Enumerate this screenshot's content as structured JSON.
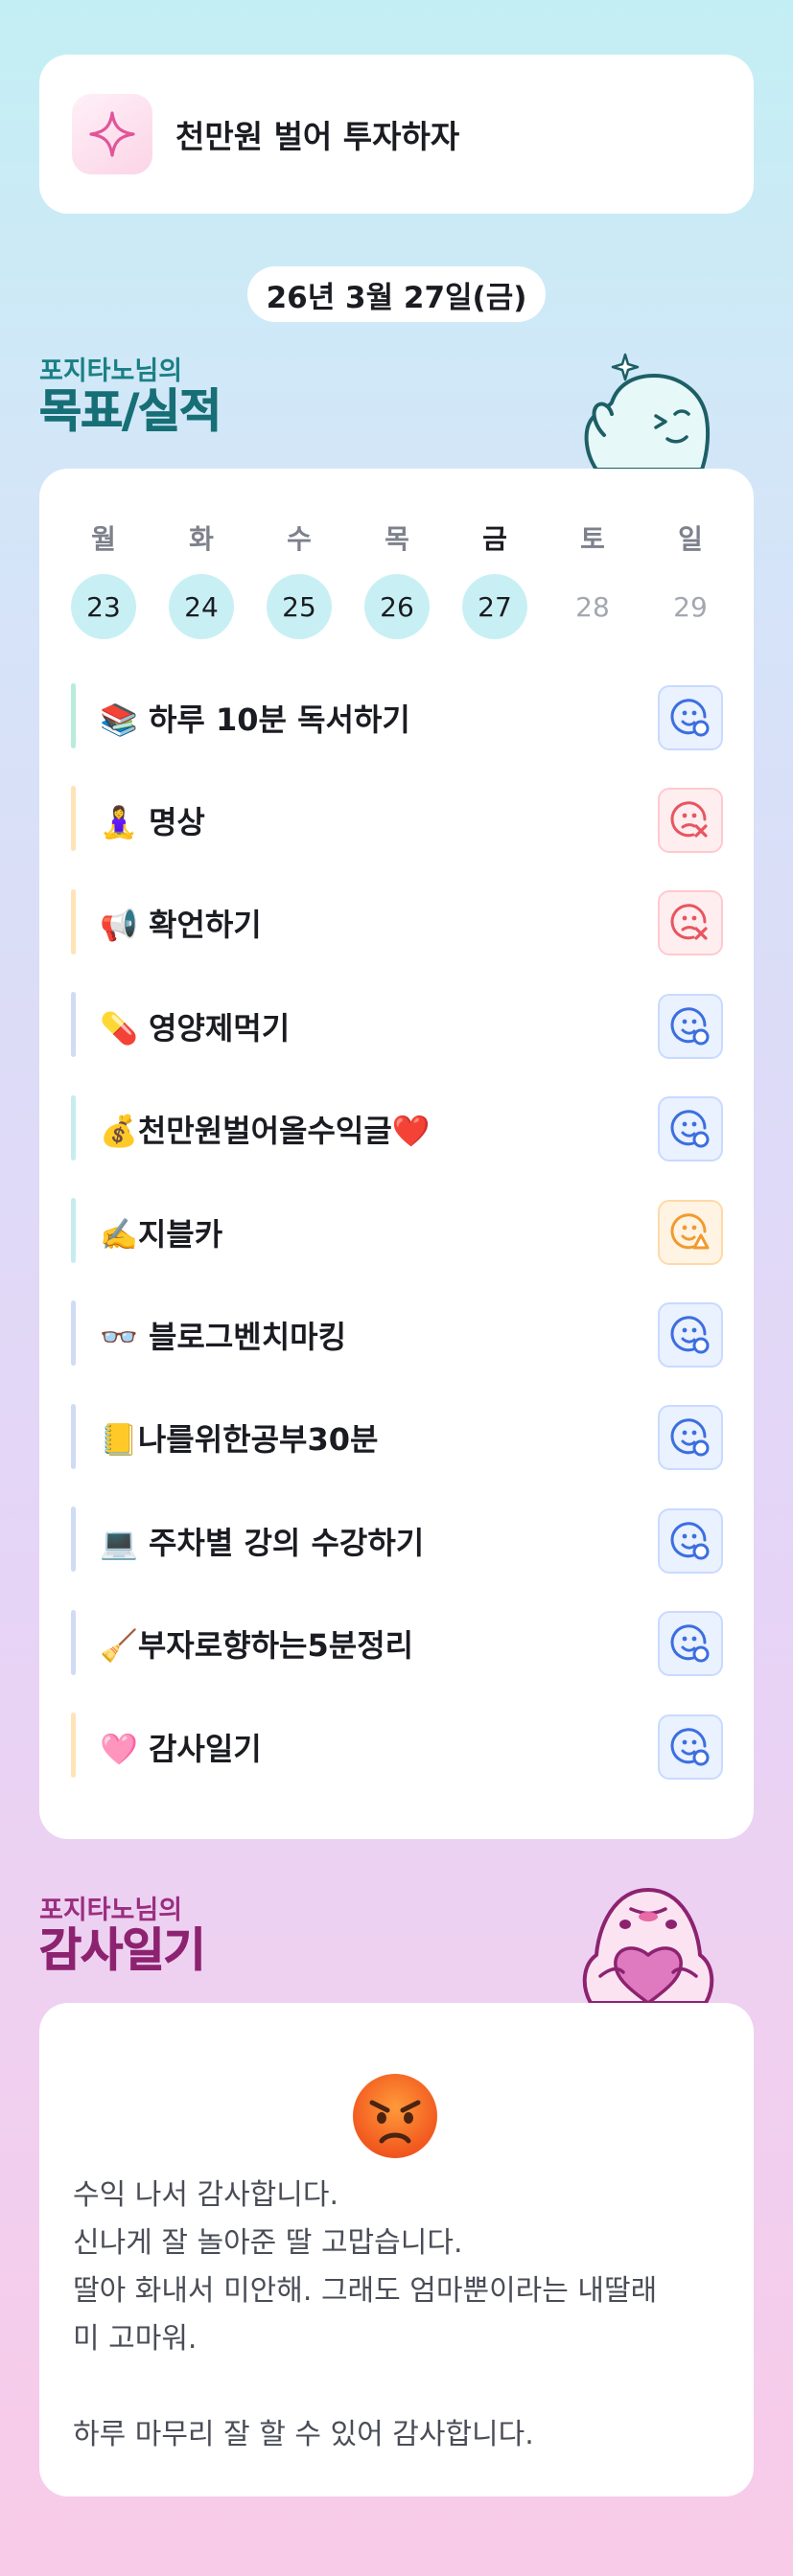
{
  "motto": {
    "text": "천만원 벌어 투자하자",
    "icon": "sparkle-icon"
  },
  "date": {
    "label": "26년 3월 27일(금)"
  },
  "goals_section": {
    "subtitle": "포지타노님의",
    "title": "목표/실적"
  },
  "week": {
    "days": [
      {
        "name": "월",
        "date": "23",
        "state": "filled"
      },
      {
        "name": "화",
        "date": "24",
        "state": "filled"
      },
      {
        "name": "수",
        "date": "25",
        "state": "filled"
      },
      {
        "name": "목",
        "date": "26",
        "state": "filled"
      },
      {
        "name": "금",
        "date": "27",
        "state": "filled",
        "today": true
      },
      {
        "name": "토",
        "date": "28",
        "state": "future"
      },
      {
        "name": "일",
        "date": "29",
        "state": "future"
      }
    ]
  },
  "goals": [
    {
      "label": "📚 하루 10분 독서하기",
      "status": "done",
      "bar": "#b8ecd8"
    },
    {
      "label": "🧘‍♀️ 명상",
      "status": "fail",
      "bar": "#ffe3b8"
    },
    {
      "label": "📢 확언하기",
      "status": "fail",
      "bar": "#ffe3b8"
    },
    {
      "label": "💊 영양제먹기",
      "status": "done",
      "bar": "#d0dcf5"
    },
    {
      "label": "💰천만원벌어올수익글❤️",
      "status": "done",
      "bar": "#c7ecef"
    },
    {
      "label": "✍️지블카",
      "status": "partial",
      "bar": "#c7ecef"
    },
    {
      "label": "👓 블로그벤치마킹",
      "status": "done",
      "bar": "#d0dcf5"
    },
    {
      "label": "📒나를위한공부30분",
      "status": "done",
      "bar": "#d0dcf5"
    },
    {
      "label": "💻 주차별 강의 수강하기",
      "status": "done",
      "bar": "#d0dcf5"
    },
    {
      "label": "🧹부자로향하는5분정리",
      "status": "done",
      "bar": "#d0dcf5"
    },
    {
      "label": "🩷 감사일기",
      "status": "done",
      "bar": "#ffe3b8"
    }
  ],
  "status_colors": {
    "done": "#3b6fe0",
    "fail": "#e8555f",
    "partial": "#f29a2e"
  },
  "gratitude_section": {
    "subtitle": "포지타노님의",
    "title": "감사일기"
  },
  "gratitude": {
    "mood": "angry-face-icon",
    "lines": [
      "수익 나서 감사합니다.",
      "신나게 잘 놀아준 딸 고맙습니다.",
      "딸아 화내서 미안해. 그래도 엄마뿐이라는 내딸래",
      "미 고마워.",
      "",
      "하루 마무리 잘 할 수 있어 감사합니다."
    ]
  }
}
